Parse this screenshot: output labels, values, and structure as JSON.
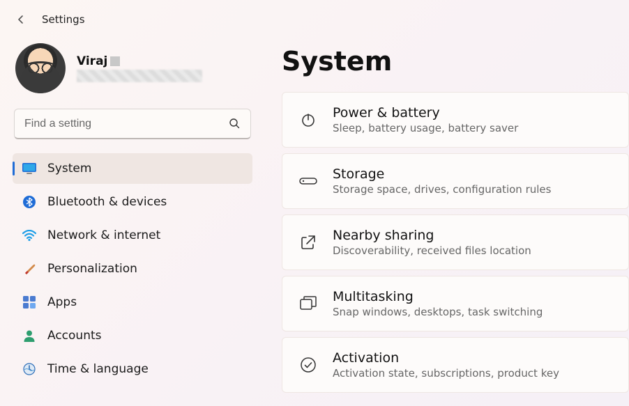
{
  "app_title": "Settings",
  "profile": {
    "name": "Viraj"
  },
  "search": {
    "placeholder": "Find a setting"
  },
  "nav": {
    "items": [
      {
        "label": "System",
        "icon": "monitor",
        "selected": true
      },
      {
        "label": "Bluetooth & devices",
        "icon": "bluetooth",
        "selected": false
      },
      {
        "label": "Network & internet",
        "icon": "wifi",
        "selected": false
      },
      {
        "label": "Personalization",
        "icon": "brush",
        "selected": false
      },
      {
        "label": "Apps",
        "icon": "apps",
        "selected": false
      },
      {
        "label": "Accounts",
        "icon": "person",
        "selected": false
      },
      {
        "label": "Time & language",
        "icon": "clock",
        "selected": false
      }
    ]
  },
  "page_title": "System",
  "cards": [
    {
      "title": "Power & battery",
      "desc": "Sleep, battery usage, battery saver",
      "icon": "power"
    },
    {
      "title": "Storage",
      "desc": "Storage space, drives, configuration rules",
      "icon": "storage"
    },
    {
      "title": "Nearby sharing",
      "desc": "Discoverability, received files location",
      "icon": "share"
    },
    {
      "title": "Multitasking",
      "desc": "Snap windows, desktops, task switching",
      "icon": "multitask"
    },
    {
      "title": "Activation",
      "desc": "Activation state, subscriptions, product key",
      "icon": "check"
    }
  ]
}
